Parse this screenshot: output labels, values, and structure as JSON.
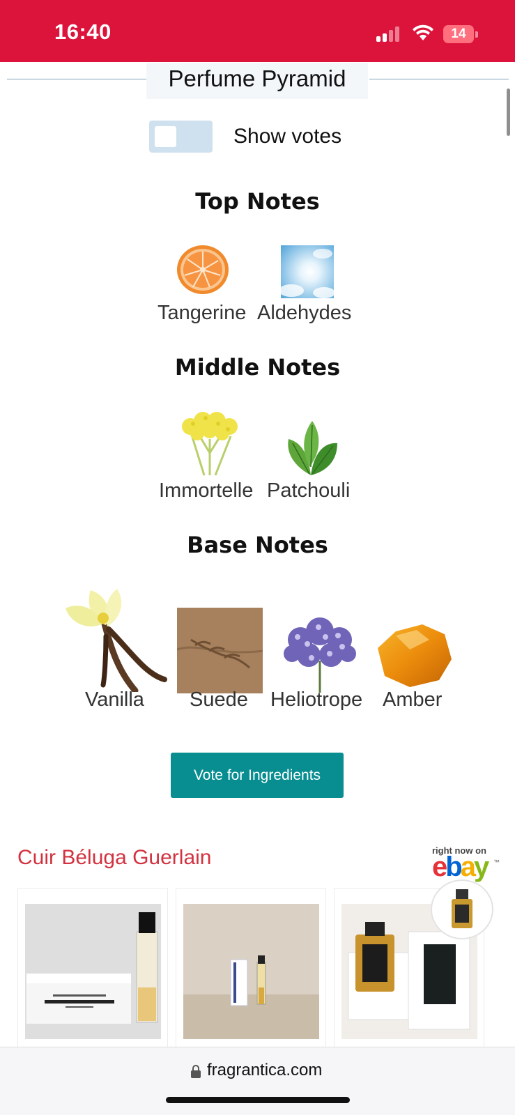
{
  "status_bar": {
    "time": "16:40",
    "battery": "14",
    "signal_icon": "cellular-signal-icon",
    "wifi_icon": "wifi-icon",
    "battery_icon": "battery-icon"
  },
  "pyramid": {
    "title": "Perfume Pyramid",
    "toggle_label": "Show votes",
    "toggle_on": false,
    "sections": {
      "top": {
        "title": "Top Notes",
        "notes": [
          "Tangerine",
          "Aldehydes"
        ]
      },
      "middle": {
        "title": "Middle Notes",
        "notes": [
          "Immortelle",
          "Patchouli"
        ]
      },
      "base": {
        "title": "Base Notes",
        "notes": [
          "Vanilla",
          "Suede",
          "Heliotrope",
          "Amber"
        ]
      }
    },
    "vote_button": "Vote for Ingredients"
  },
  "ebay": {
    "title": "Cuir Béluga Guerlain",
    "right_now_label": "right now on",
    "logo": {
      "e": "e",
      "b": "b",
      "a": "a",
      "y": "y"
    },
    "tm": "™"
  },
  "browser": {
    "url": "fragrantica.com",
    "lock_icon": "lock-icon"
  },
  "colors": {
    "status_bar": "#dc143c",
    "button": "#088e91",
    "ebay_title": "#d23240"
  }
}
